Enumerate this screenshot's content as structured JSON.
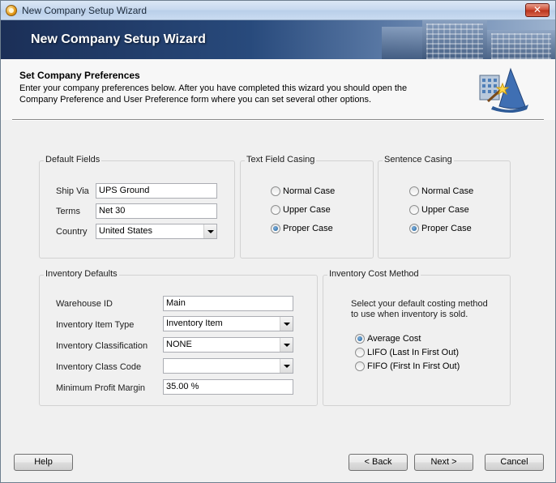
{
  "window": {
    "title": "New Company Setup Wizard"
  },
  "banner": {
    "title": "New Company Setup Wizard"
  },
  "header": {
    "title": "Set Company Preferences",
    "description_line1": "Enter your company preferences below. After you have completed this wizard you should open the",
    "description_line2": "Company Preference and User Preference form where you can set several other options."
  },
  "default_fields": {
    "legend": "Default Fields",
    "ship_via_label": "Ship Via",
    "ship_via_value": "UPS Ground",
    "terms_label": "Terms",
    "terms_value": "Net 30",
    "country_label": "Country",
    "country_value": "United States"
  },
  "text_field_casing": {
    "legend": "Text Field Casing",
    "options": [
      "Normal Case",
      "Upper Case",
      "Proper Case"
    ],
    "selected": "Proper Case"
  },
  "sentence_casing": {
    "legend": "Sentence Casing",
    "options": [
      "Normal Case",
      "Upper Case",
      "Proper Case"
    ],
    "selected": "Proper Case"
  },
  "inventory_defaults": {
    "legend": "Inventory Defaults",
    "warehouse_id_label": "Warehouse ID",
    "warehouse_id_value": "Main",
    "item_type_label": "Inventory Item Type",
    "item_type_value": "Inventory Item",
    "classification_label": "Inventory Classification",
    "classification_value": "NONE",
    "class_code_label": "Inventory Class Code",
    "class_code_value": "",
    "min_profit_label": "Minimum Profit Margin",
    "min_profit_value": "35.00 %"
  },
  "inventory_cost": {
    "legend": "Inventory Cost Method",
    "desc_line1": "Select your default costing method",
    "desc_line2": "to use when inventory is sold.",
    "options": [
      "Average Cost",
      "LIFO (Last In First Out)",
      "FIFO (First In First Out)"
    ],
    "selected": "Average Cost"
  },
  "buttons": {
    "help": "Help",
    "back": "< Back",
    "next": "Next >",
    "cancel": "Cancel"
  },
  "icons": {
    "app": "app-icon",
    "close": "close-icon",
    "wizard": "wizard-icon",
    "dropdown": "chevron-down-icon"
  },
  "colors": {
    "banner_dark": "#1b2f57",
    "banner_light": "#9db3cf",
    "dialog_bg": "#f0f0f0"
  }
}
